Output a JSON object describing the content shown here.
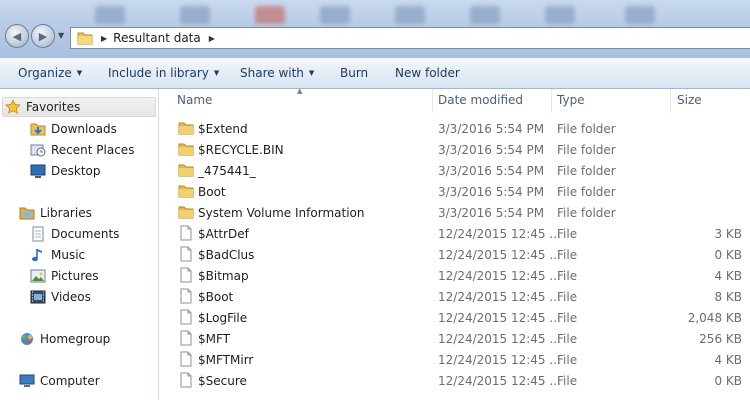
{
  "address_bar": {
    "crumb": "Resultant data"
  },
  "toolbar": {
    "organize": "Organize",
    "include_in_library": "Include in library",
    "share_with": "Share with",
    "burn": "Burn",
    "new_folder": "New folder"
  },
  "nav_pane": {
    "favorites": {
      "label": "Favorites",
      "icon": "star-icon"
    },
    "favorites_items": [
      {
        "label": "Downloads",
        "icon": "downloads-folder-icon"
      },
      {
        "label": "Recent Places",
        "icon": "recent-places-icon"
      },
      {
        "label": "Desktop",
        "icon": "desktop-icon"
      }
    ],
    "libraries": {
      "label": "Libraries",
      "icon": "libraries-icon"
    },
    "libraries_items": [
      {
        "label": "Documents",
        "icon": "documents-icon"
      },
      {
        "label": "Music",
        "icon": "music-icon"
      },
      {
        "label": "Pictures",
        "icon": "pictures-icon"
      },
      {
        "label": "Videos",
        "icon": "videos-icon"
      }
    ],
    "homegroup": {
      "label": "Homegroup",
      "icon": "homegroup-icon"
    },
    "computer": {
      "label": "Computer",
      "icon": "computer-icon"
    }
  },
  "columns": {
    "name": "Name",
    "date_modified": "Date modified",
    "type": "Type",
    "size": "Size"
  },
  "files": [
    {
      "name": "$Extend",
      "date": "3/3/2016 5:54 PM",
      "type": "File folder",
      "size": "",
      "icon": "folder-icon"
    },
    {
      "name": "$RECYCLE.BIN",
      "date": "3/3/2016 5:54 PM",
      "type": "File folder",
      "size": "",
      "icon": "folder-icon"
    },
    {
      "name": "_475441_",
      "date": "3/3/2016 5:54 PM",
      "type": "File folder",
      "size": "",
      "icon": "folder-icon"
    },
    {
      "name": "Boot",
      "date": "3/3/2016 5:54 PM",
      "type": "File folder",
      "size": "",
      "icon": "folder-icon"
    },
    {
      "name": "System Volume Information",
      "date": "3/3/2016 5:54 PM",
      "type": "File folder",
      "size": "",
      "icon": "folder-icon"
    },
    {
      "name": "$AttrDef",
      "date": "12/24/2015 12:45 ...",
      "type": "File",
      "size": "3 KB",
      "icon": "file-icon"
    },
    {
      "name": "$BadClus",
      "date": "12/24/2015 12:45 ...",
      "type": "File",
      "size": "0 KB",
      "icon": "file-icon"
    },
    {
      "name": "$Bitmap",
      "date": "12/24/2015 12:45 ...",
      "type": "File",
      "size": "4 KB",
      "icon": "file-icon"
    },
    {
      "name": "$Boot",
      "date": "12/24/2015 12:45 ...",
      "type": "File",
      "size": "8 KB",
      "icon": "file-icon"
    },
    {
      "name": "$LogFile",
      "date": "12/24/2015 12:45 ...",
      "type": "File",
      "size": "2,048 KB",
      "icon": "file-icon"
    },
    {
      "name": "$MFT",
      "date": "12/24/2015 12:45 ...",
      "type": "File",
      "size": "256 KB",
      "icon": "file-icon"
    },
    {
      "name": "$MFTMirr",
      "date": "12/24/2015 12:45 ...",
      "type": "File",
      "size": "4 KB",
      "icon": "file-icon"
    },
    {
      "name": "$Secure",
      "date": "12/24/2015 12:45 ...",
      "type": "File",
      "size": "0 KB",
      "icon": "file-icon"
    }
  ]
}
